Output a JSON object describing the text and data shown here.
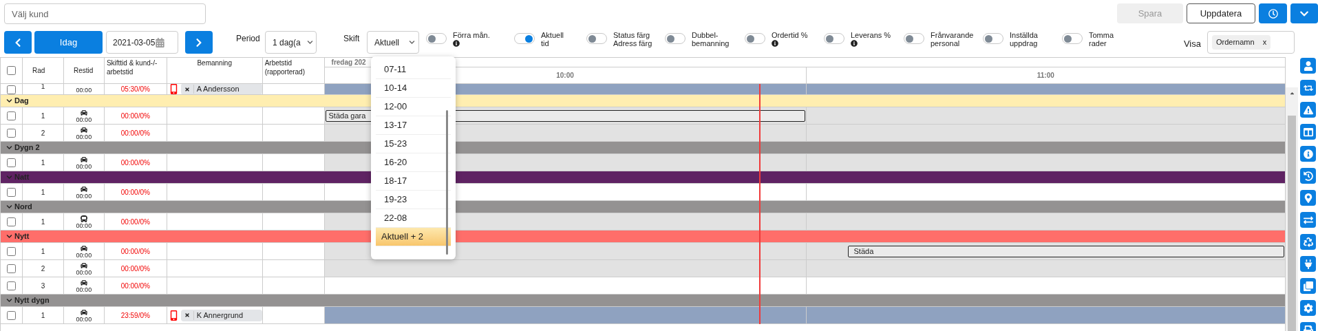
{
  "customer_search": {
    "placeholder": "Välj kund"
  },
  "actions": [
    {
      "label": "Spara",
      "disabled": true
    },
    {
      "label": "Uppdatera",
      "disabled": false
    }
  ],
  "toolbar": {
    "today": "Idag",
    "date": "2021-03-05",
    "period": {
      "label": "Period",
      "value": "1 dag(a"
    },
    "shift": {
      "label": "Skift",
      "value": "Aktuell"
    }
  },
  "toggles": [
    {
      "label": "Förra mån.",
      "on": false,
      "info": true
    },
    {
      "label": "Aktuell\ntid",
      "on": true,
      "info": false
    },
    {
      "label": "Status färg\nAdress färg",
      "on": false,
      "info": false
    },
    {
      "label": "Dubbel-\nbemanning",
      "on": false,
      "info": false
    },
    {
      "label": "Ordertid %",
      "on": false,
      "info": true
    },
    {
      "label": "Leverans %",
      "on": false,
      "info": true
    },
    {
      "label": "Frånvarande\npersonal",
      "on": false,
      "info": false
    },
    {
      "label": "Inställda\nuppdrag",
      "on": false,
      "info": false
    },
    {
      "label": "Tomma\nrader",
      "on": false,
      "info": false
    }
  ],
  "visa": {
    "label": "Visa",
    "tags": [
      {
        "label": "Ordernamn",
        "remove": "x"
      }
    ]
  },
  "shift_dropdown": {
    "options": [
      {
        "label": "07-11",
        "selected": false
      },
      {
        "label": "10-14",
        "selected": false
      },
      {
        "label": "12-00",
        "selected": false
      },
      {
        "label": "13-17",
        "selected": false
      },
      {
        "label": "15-23",
        "selected": false
      },
      {
        "label": "16-20",
        "selected": false
      },
      {
        "label": "18-17",
        "selected": false
      },
      {
        "label": "19-23",
        "selected": false
      },
      {
        "label": "22-08",
        "selected": false
      },
      {
        "label": "Aktuell + 2",
        "selected": true
      }
    ]
  },
  "table": {
    "select_all": {
      "checked": false
    },
    "columns": [
      "Rad",
      "Restid",
      "Skifttid & kund-/-arbetstid",
      "Bemanning",
      "Arbetstid (rapporterad)"
    ],
    "timeline": {
      "date": "fredag 202",
      "hours": [
        "10:00",
        "11:00"
      ]
    },
    "rows": [
      {
        "kind": "partial_row",
        "checked": false,
        "rad": "1",
        "restid": "00:00",
        "time": "05:30/0%",
        "staff": "A Andersson",
        "lane": {
          "kind": "blue"
        }
      },
      {
        "kind": "group",
        "label": "Dag",
        "color": "#ffeeb0"
      },
      {
        "kind": "row",
        "checked": false,
        "rad": "1",
        "restid": "00:00",
        "vehicle": {
          "kind": "car"
        },
        "time": "00:00/0%",
        "lane": {
          "kind": "grey"
        },
        "task": {
          "label": "Städa gara",
          "kind": "first_hour"
        }
      },
      {
        "kind": "row",
        "checked": false,
        "rad": "2",
        "restid": "00:00",
        "vehicle": {
          "kind": "car"
        },
        "time": "00:00/0%",
        "lane": {
          "kind": "grey"
        }
      },
      {
        "kind": "group",
        "label": "Dygn 2",
        "color": "#949292"
      },
      {
        "kind": "row",
        "checked": false,
        "rad": "1",
        "restid": "00:00",
        "vehicle": {
          "kind": "car"
        },
        "time": "00:00/0%",
        "lane": {
          "kind": "grey"
        }
      },
      {
        "kind": "group",
        "label": "Natt",
        "color": "#5f2363"
      },
      {
        "kind": "row",
        "checked": false,
        "rad": "1",
        "restid": "00:00",
        "vehicle": {
          "kind": "car"
        },
        "time": "00:00/0%",
        "lane": {
          "kind": "white"
        }
      },
      {
        "kind": "group",
        "label": "Nord",
        "color": "#949292"
      },
      {
        "kind": "row",
        "checked": false,
        "rad": "1",
        "restid": "00:00",
        "vehicle": {
          "kind": "bus"
        },
        "time": "00:00/0%",
        "lane": {
          "kind": "grey"
        }
      },
      {
        "kind": "group",
        "label": "Nytt",
        "color": "#ff6e6a"
      },
      {
        "kind": "row",
        "checked": false,
        "rad": "1",
        "restid": "00:00",
        "vehicle": {
          "kind": "car"
        },
        "time": "00:00/0%",
        "lane": {
          "kind": "grey"
        },
        "task": {
          "label": "Städa",
          "kind": "second_hour"
        }
      },
      {
        "kind": "row",
        "checked": false,
        "rad": "2",
        "restid": "00:00",
        "vehicle": {
          "kind": "car"
        },
        "time": "00:00/0%",
        "lane": {
          "kind": "grey"
        }
      },
      {
        "kind": "row",
        "checked": false,
        "rad": "3",
        "restid": "00:00",
        "vehicle": {
          "kind": "car"
        },
        "time": "00:00/0%",
        "lane": {
          "kind": "white"
        }
      },
      {
        "kind": "group",
        "label": "Nytt dygn",
        "color": "#949292"
      },
      {
        "kind": "row",
        "checked": false,
        "rad": "1",
        "restid": "00:00",
        "vehicle": {
          "kind": "car"
        },
        "time": "23:59/0%",
        "staff": "K Annergrund",
        "lane": {
          "kind": "blue"
        }
      }
    ]
  }
}
